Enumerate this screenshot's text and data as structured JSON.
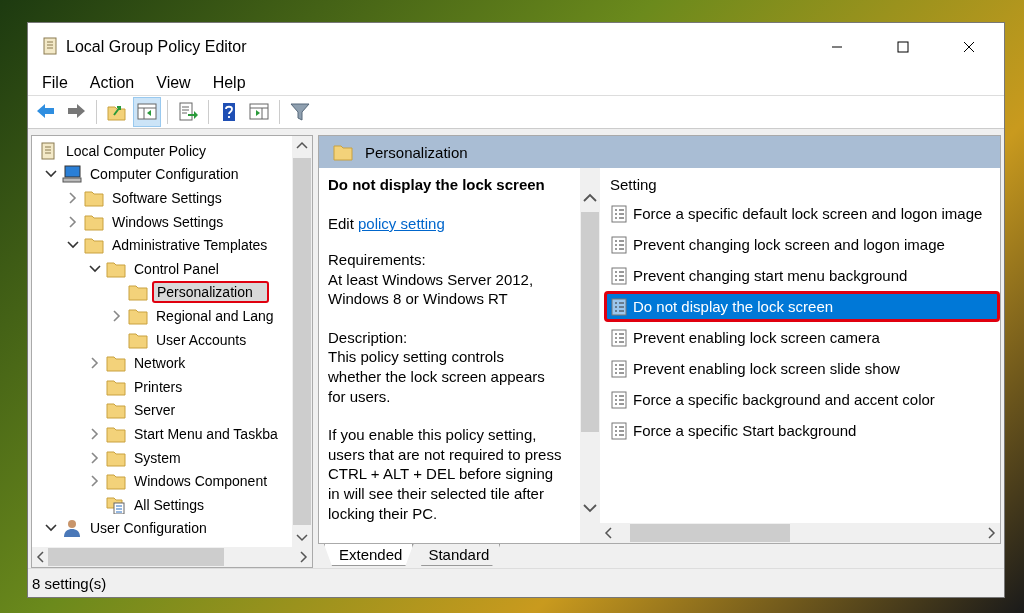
{
  "window": {
    "title": "Local Group Policy Editor"
  },
  "menu": [
    {
      "label": "File"
    },
    {
      "label": "Action"
    },
    {
      "label": "View"
    },
    {
      "label": "Help"
    }
  ],
  "toolbar": [
    {
      "kind": "back",
      "pressed": false
    },
    {
      "kind": "forward",
      "pressed": false
    },
    {
      "kind": "sep"
    },
    {
      "kind": "up",
      "pressed": false
    },
    {
      "kind": "tree",
      "pressed": true
    },
    {
      "kind": "sep"
    },
    {
      "kind": "export",
      "pressed": false
    },
    {
      "kind": "sep"
    },
    {
      "kind": "help",
      "pressed": false
    },
    {
      "kind": "pane",
      "pressed": false
    },
    {
      "kind": "sep"
    },
    {
      "kind": "filter",
      "pressed": false
    }
  ],
  "tree": [
    {
      "label": "Local Computer Policy",
      "kind": "policy",
      "selected": false,
      "highlighted": false,
      "children": [
        {
          "label": "Computer Configuration",
          "kind": "computer",
          "expanded": true,
          "selected": false,
          "highlighted": false,
          "children": [
            {
              "label": "Software Settings",
              "kind": "folder",
              "expanded": false,
              "selected": false,
              "highlighted": false
            },
            {
              "label": "Windows Settings",
              "kind": "folder",
              "expanded": false,
              "selected": false,
              "highlighted": false
            },
            {
              "label": "Administrative Templates",
              "kind": "folder",
              "expanded": true,
              "selected": false,
              "highlighted": false,
              "children": [
                {
                  "label": "Control Panel",
                  "kind": "folder",
                  "expanded": true,
                  "selected": false,
                  "highlighted": false,
                  "children": [
                    {
                      "label": "Personalization",
                      "kind": "folder",
                      "selected": true,
                      "highlighted": true
                    },
                    {
                      "label": "Regional and Lang",
                      "kind": "folder",
                      "expanded": false,
                      "selected": false,
                      "highlighted": false
                    },
                    {
                      "label": "User Accounts",
                      "kind": "folder",
                      "selected": false,
                      "highlighted": false
                    }
                  ]
                },
                {
                  "label": "Network",
                  "kind": "folder",
                  "expanded": false,
                  "selected": false,
                  "highlighted": false
                },
                {
                  "label": "Printers",
                  "kind": "folder",
                  "selected": false,
                  "highlighted": false
                },
                {
                  "label": "Server",
                  "kind": "folder",
                  "selected": false,
                  "highlighted": false
                },
                {
                  "label": "Start Menu and Taskba",
                  "kind": "folder",
                  "expanded": false,
                  "selected": false,
                  "highlighted": false
                },
                {
                  "label": "System",
                  "kind": "folder",
                  "expanded": false,
                  "selected": false,
                  "highlighted": false
                },
                {
                  "label": "Windows Component",
                  "kind": "folder",
                  "expanded": false,
                  "selected": false,
                  "highlighted": false
                },
                {
                  "label": "All Settings",
                  "kind": "settings",
                  "selected": false,
                  "highlighted": false
                }
              ]
            }
          ]
        },
        {
          "label": "User Configuration",
          "kind": "user",
          "expanded": true,
          "selected": false,
          "highlighted": false
        }
      ]
    }
  ],
  "details": {
    "header": "Personalization",
    "title": "Do not display the lock screen",
    "edit_prefix": "Edit",
    "edit_link": "policy setting",
    "paragraphs": [
      [
        "Requirements:",
        "At least Windows Server 2012,",
        "Windows 8 or Windows RT"
      ],
      [
        "Description:",
        "This policy setting controls",
        "whether the lock screen appears",
        "for users."
      ],
      [
        "If you enable this policy setting,",
        "users that are not required to press",
        "CTRL + ALT + DEL before signing",
        "in will see their selected tile after",
        "locking their PC."
      ]
    ]
  },
  "settings": {
    "column": "Setting",
    "rows": [
      {
        "name": "Force a specific default lock screen and logon image",
        "selected": false,
        "highlighted": false
      },
      {
        "name": "Prevent changing lock screen and logon image",
        "selected": false,
        "highlighted": false
      },
      {
        "name": "Prevent changing start menu background",
        "selected": false,
        "highlighted": false
      },
      {
        "name": "Do not display the lock screen",
        "selected": true,
        "highlighted": true
      },
      {
        "name": "Prevent enabling lock screen camera",
        "selected": false,
        "highlighted": false
      },
      {
        "name": "Prevent enabling lock screen slide show",
        "selected": false,
        "highlighted": false
      },
      {
        "name": "Force a specific background and accent color",
        "selected": false,
        "highlighted": false
      },
      {
        "name": "Force a specific Start background",
        "selected": false,
        "highlighted": false
      }
    ]
  },
  "tabs": [
    {
      "label": "Extended",
      "selected": true
    },
    {
      "label": "Standard",
      "selected": false
    }
  ],
  "status_bar": "8 setting(s)"
}
